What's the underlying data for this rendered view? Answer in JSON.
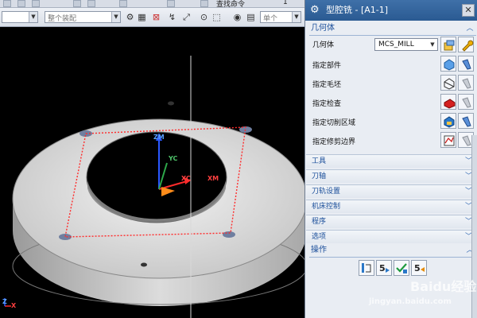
{
  "menubar": {
    "cmd_find": "查找命令",
    "cmd_num": "1"
  },
  "toolbar": {
    "filter_combo": "整个装配",
    "search_combo": "单个"
  },
  "viewport": {
    "axes": {
      "zm": "ZM",
      "xc": "XC",
      "xm": "XM",
      "yc": "YC",
      "z_small": "Z",
      "x_small": "X"
    }
  },
  "dialog": {
    "title": "型腔铣 - [A1-1]",
    "geometry_section": "几何体",
    "geometry_label": "几何体",
    "geometry_value": "MCS_MILL",
    "rows": [
      {
        "label": "指定部件",
        "icon": "part-icon"
      },
      {
        "label": "指定毛坯",
        "icon": "blank-icon"
      },
      {
        "label": "指定检查",
        "icon": "check-icon"
      },
      {
        "label": "指定切削区域",
        "icon": "cut-area-icon"
      },
      {
        "label": "指定修剪边界",
        "icon": "trim-boundary-icon"
      }
    ],
    "collapsed_sections": [
      "工具",
      "刀轴",
      "刀轨设置",
      "机床控制",
      "程序",
      "选项"
    ],
    "operations_section": "操作",
    "operation_buttons": [
      "generate-icon",
      "replay-icon",
      "verify-icon",
      "list-icon"
    ]
  },
  "watermark": {
    "brand": "Baidu经验",
    "url": "jingyan.baidu.com"
  },
  "colors": {
    "dialog_title_bg": "#2f5f96",
    "section_text": "#1a4e9a",
    "boundary_red": "#ff2b2b",
    "part_gray": "#c9c9c9"
  }
}
